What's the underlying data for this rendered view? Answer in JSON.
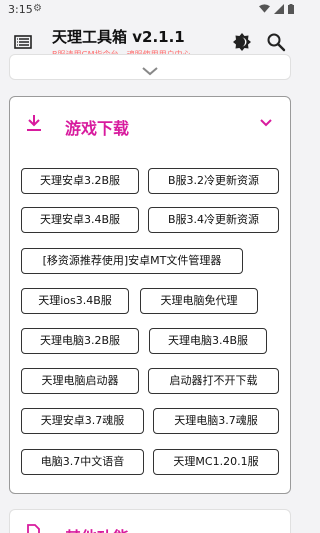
{
  "status_bar": {
    "time": "3:15"
  },
  "app_bar": {
    "title": "天理工具箱 v2.1.1",
    "subtitle": "B服请用GM指令台，魂服使用用户中心"
  },
  "section": {
    "title": "游戏下载",
    "buttons": [
      "天理安卓3.2B服",
      "B服3.2冷更新资源",
      "天理安卓3.4B服",
      "B服3.4冷更新资源",
      "[移资源推荐使用]安卓MT文件管理器",
      "天理ios3.4B服",
      "天理电脑免代理",
      "天理电脑3.2B服",
      "天理电脑3.4B服",
      "天理电脑启动器",
      "启动器打不开下载",
      "天理安卓3.7魂服",
      "天理电脑3.7魂服",
      "电脑3.7中文语音",
      "天理MC1.20.1服"
    ]
  },
  "next_section": {
    "title": "其他功能"
  },
  "colors": {
    "accent": "#d81b9e",
    "subtitle": "#ff6d6d"
  }
}
